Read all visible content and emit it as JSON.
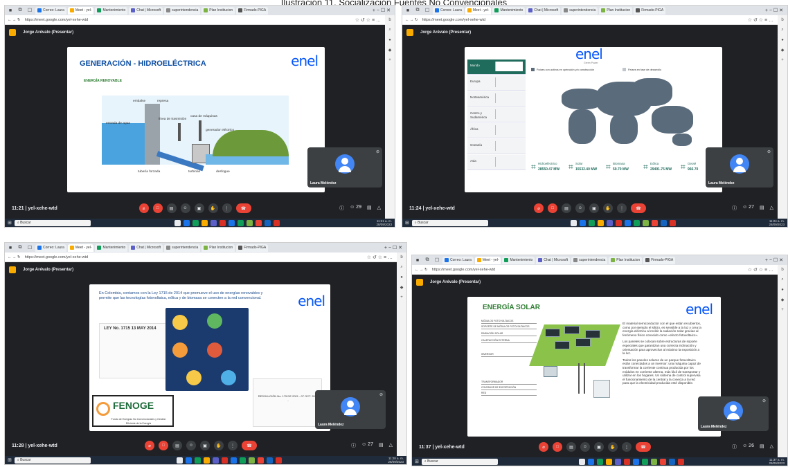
{
  "figure_title": "Ilustración 11. Socialización Fuentes No Convencionales",
  "browser": {
    "tabs": [
      "Correo: Laura",
      "Meet - yel-",
      "Mantenimiento",
      "Chat | Microsoft",
      "superintendencia",
      "Plan Institucion",
      "Firmado-PIGA"
    ],
    "url": "https://meet.google.com/yel-xehe-wtd"
  },
  "meeting": {
    "presenter": "Jorge Arévalo (Presentar)",
    "code": "yel-xehe-wtd",
    "participant": "Laura Meléndez"
  },
  "taskbar": {
    "search": "Buscar"
  },
  "panels": [
    {
      "time": "11:21",
      "clock": "11:21 a. m.\n28/09/2023",
      "people_count": "29",
      "slide_title": "GENERACIÓN - HIDROELÉCTRICA",
      "logo": "enel",
      "subtitle": "ENERGÍA RENOVABLE",
      "labels": [
        "embalse",
        "represa",
        "entrada de agua",
        "línea de trasmisión",
        "casa de máquinas",
        "generador eléctrico",
        "tubería forzada",
        "turbinas",
        "desfogue"
      ]
    },
    {
      "time": "11:24",
      "clock": "11:24 a. m.\n28/09/2023",
      "people_count": "27",
      "logo": "enel",
      "logo_sub": "Green Power",
      "legend": [
        "Países con activos en operación y/o construcción",
        "Países en fase de desarrollo"
      ],
      "regions": [
        "Mundo",
        "Europa",
        "Norteamérica",
        "Centro y Sudamérica",
        "África",
        "Oceanía",
        "Asia"
      ],
      "stats": [
        {
          "name": "Hidroeléctrico",
          "value": "28550.47 MW"
        },
        {
          "name": "Solar",
          "value": "15532.40 MW"
        },
        {
          "name": "Biomasa",
          "value": "59.70 MW"
        },
        {
          "name": "Eólica",
          "value": "29491.75 MW"
        },
        {
          "name": "Geoté",
          "value": "966.70"
        }
      ]
    },
    {
      "time": "11:28",
      "clock": "11:28 a. m.\n28/09/2023",
      "people_count": "27",
      "logo": "enel",
      "intro": "En Colombia, contamos con la Ley 1715 de 2014 que promueve el uso de energías renovables y permite que las tecnologías fotovoltaica, eólica y de biomasa se conecten a la red convencional.",
      "law": "LEY No. 1715 13 MAY 2014",
      "fenoge": "FENOGE",
      "fenoge_sub": "Fondo de Energías No Convencionales y Gestión Eficiente de la Energía",
      "doc": "RESOLUCIÓN No. 175 DE 2021 - 07 OCT. 2021 -"
    },
    {
      "time": "11:37",
      "clock": "11:37 a. m.\n28/09/2023",
      "people_count": "26",
      "slide_title": "ENERGÍA SOLAR",
      "logo": "enel",
      "body": [
        "El material semiconductor con el que están recubiertos, como por ejemplo el silicio, es sensible a la luz y crea la energía eléctrica al recibir la radiación solar gracias al fenómeno físico conocido como «efecto fotovoltaico».",
        "Los paneles se colocan sobre estructuras de soporte especiales que garantizan una correcta inclinación y orientación para aprovechar al máximo la exposición a la luz.",
        "Todos los paneles solares de un parque fotovoltaico están conectados a un inversor: una máquina capaz de transformar la corriente continua producida por los módulos en corriente alterna, más fácil de transportar y utilizar en los hogares. Un sistema de control supervisa el funcionamiento de la central y la conecta a la red para que la electricidad producida esté disponible."
      ],
      "labels": [
        "MÓDULOS FOTOVOLTAICOS",
        "SOPORTE DE MÓDULOS FOTOVOLTAICOS",
        "RADIACIÓN SOLAR",
        "CALEFACCIÓN EXTERNA",
        "INVERSOR",
        "TRANSFORMADOR",
        "CONTADOR DE EXPORTACIÓN",
        "RED"
      ]
    }
  ]
}
